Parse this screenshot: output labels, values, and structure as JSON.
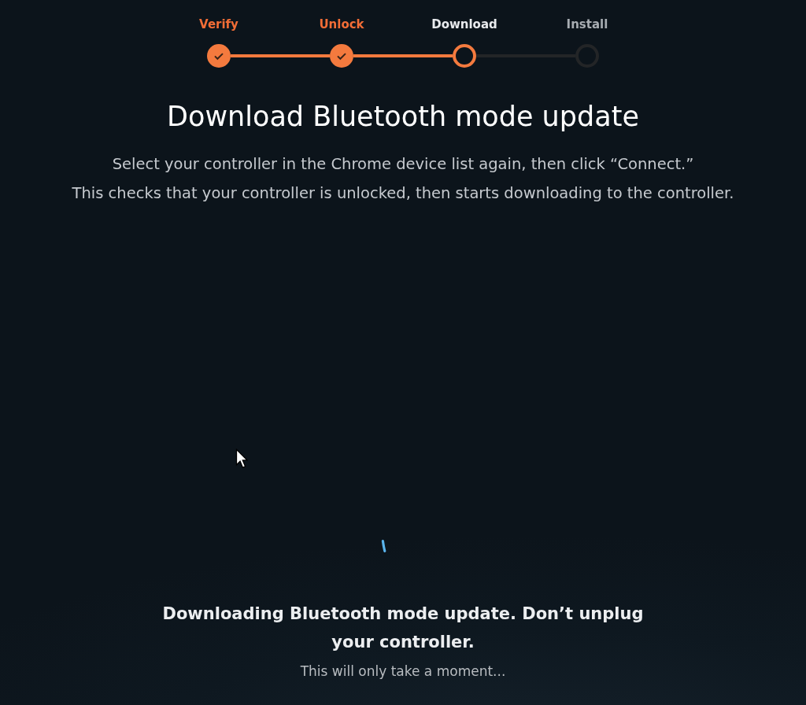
{
  "steps": [
    {
      "label": "Verify",
      "completed": true,
      "selected": false
    },
    {
      "label": "Unlock",
      "completed": true,
      "selected": false
    },
    {
      "label": "Download",
      "completed": false,
      "selected": true
    },
    {
      "label": "Install",
      "completed": false,
      "selected": false
    }
  ],
  "title": "Download Bluetooth mode update",
  "description": [
    "Select your controller in the Chrome device list again, then click “Connect.”",
    "This checks that your controller is unlocked, then starts downloading to the controller."
  ],
  "status": {
    "message": "Downloading Bluetooth mode update. Don’t unplug your controller.",
    "detail": "This will only take a moment..."
  }
}
